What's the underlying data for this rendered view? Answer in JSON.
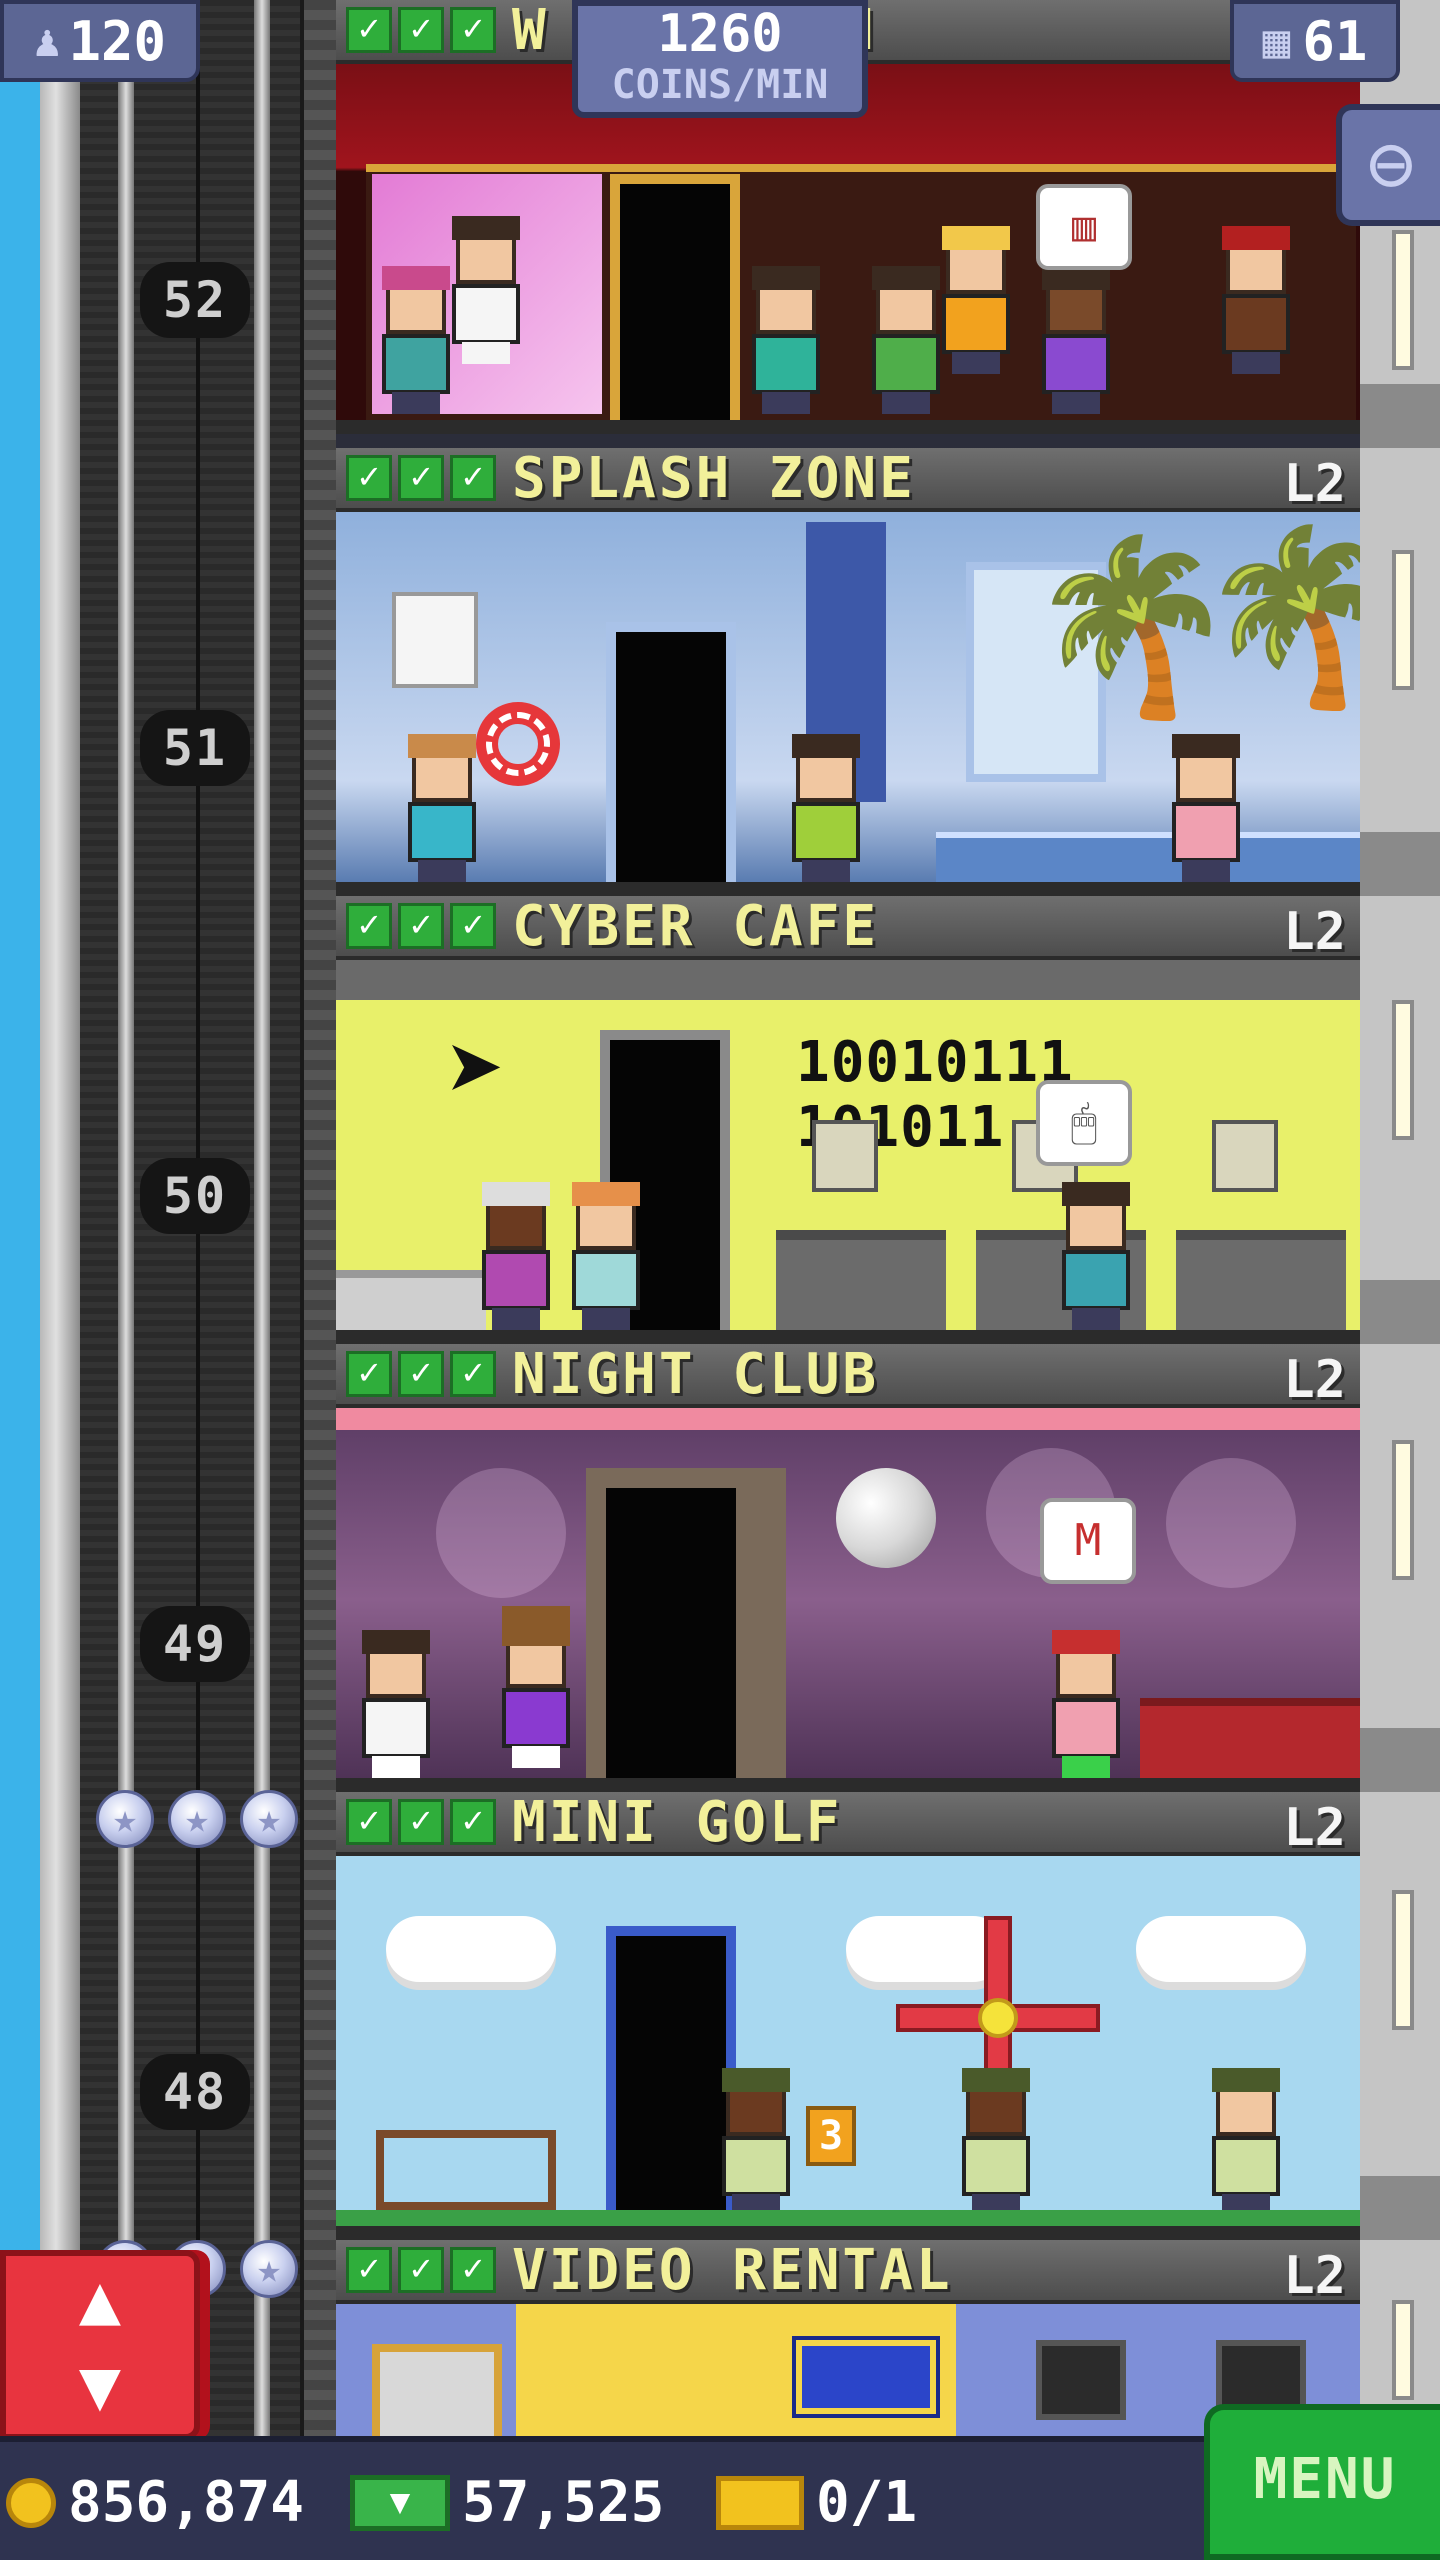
{
  "hud": {
    "population": "120",
    "coins_per_min_value": "1260",
    "coins_per_min_label": "COINS/MIN",
    "floor_count": "61"
  },
  "top_floor": {
    "name_visible": "W",
    "name_visible_end": "M"
  },
  "floors": [
    {
      "number": "52",
      "name": "SPLASH ZONE",
      "level": "L2"
    },
    {
      "number": "51",
      "name": "CYBER CAFE",
      "level": "L2"
    },
    {
      "number": "50",
      "name": "NIGHT CLUB",
      "level": "L2"
    },
    {
      "number": "49",
      "name": "MINI GOLF",
      "level": "L2"
    },
    {
      "number": "48",
      "name": "VIDEO RENTAL",
      "level": "L2"
    }
  ],
  "room_text": {
    "cyber_binary": "10010111",
    "cyber_binary_end": "101011",
    "golf_sign": "3"
  },
  "bottom_bar": {
    "coins": "856,874",
    "tower_bux": "57,525",
    "tickets": "0/1",
    "menu_label": "MENU"
  },
  "colors": {
    "hud_panel": "#5c6694",
    "check_green": "#2fae3b",
    "floor_name_yellow": "#f2f09a",
    "elevator_button_red": "#e8343f",
    "menu_green": "#1fae3a"
  },
  "icons": {
    "population": "person-icon",
    "floors": "building-icon",
    "zoom": "magnifier-minus-icon",
    "elevator": "up-down-arrows-icon",
    "coins": "coin-icon",
    "bux": "tower-bux-icon",
    "tickets": "golden-ticket-icon",
    "check": "checkmark-icon",
    "star": "star-icon"
  }
}
